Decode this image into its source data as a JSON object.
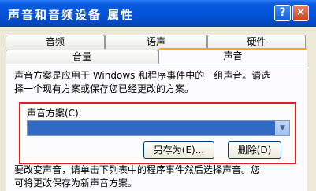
{
  "window": {
    "title": "声音和音频设备 属性",
    "help_glyph": "?",
    "close_glyph": "✕"
  },
  "tabs": {
    "row_back": [
      "音频",
      "语声",
      "硬件"
    ],
    "row_front": [
      "音量",
      "声音"
    ],
    "active": "声音"
  },
  "panel": {
    "description_line1": "声音方案是应用于 Windows 和程序事件中的一组声音。请选",
    "description_line2": "择一个现有方案或保存您已经更改的方案。",
    "scheme_label": "声音方案(C):",
    "scheme_selected": "",
    "save_as_label": "另存为(E)...",
    "delete_label": "删除(D)",
    "instruction_line1": "要改变声音，请单击下列表中的程序事件然后选择声音。您",
    "instruction_line2": "可将更改保存为新声音方案。"
  },
  "colors": {
    "titlebar": "#0354d8",
    "highlight_border": "#e02020",
    "selection": "#316ac5",
    "tab_accent": "#f4a81e"
  }
}
